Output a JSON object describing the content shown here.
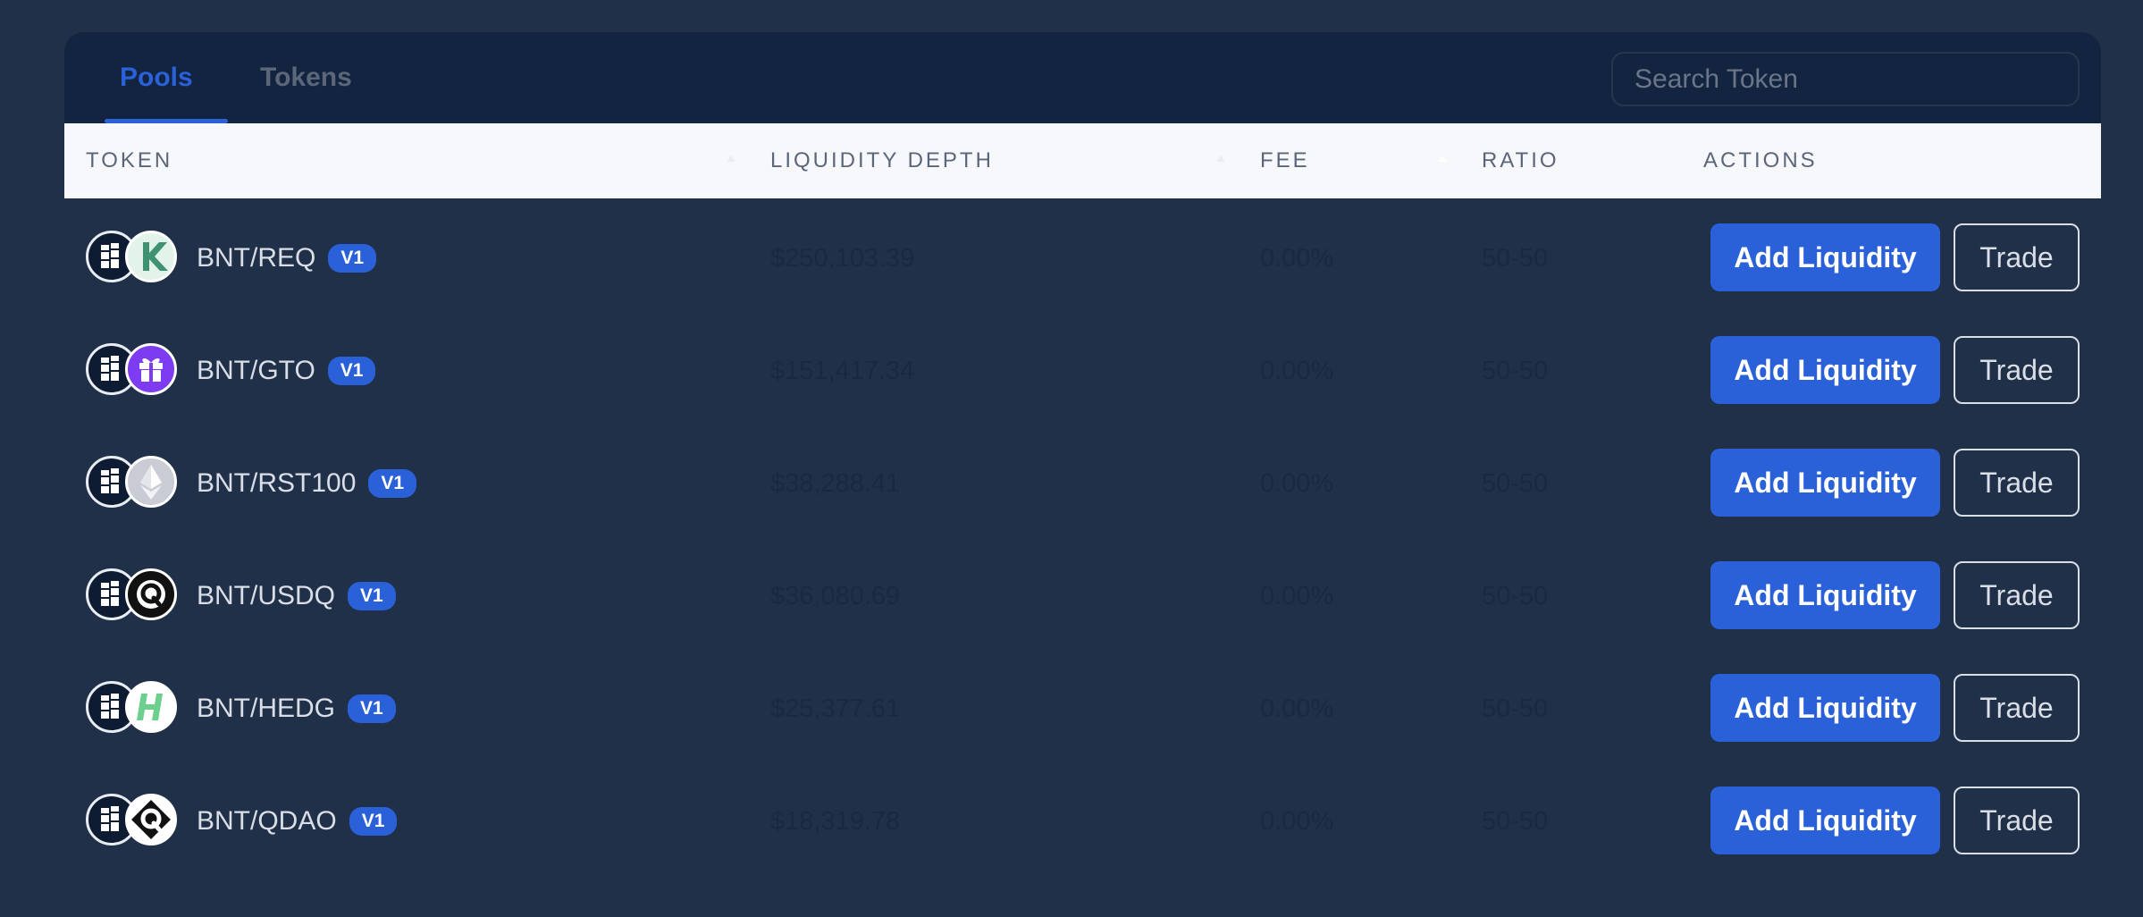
{
  "tabs": [
    {
      "label": "Pools",
      "active": true
    },
    {
      "label": "Tokens",
      "active": false
    }
  ],
  "search": {
    "placeholder": "Search Token",
    "value": ""
  },
  "table": {
    "columns": [
      "TOKEN",
      "LIQUIDITY DEPTH",
      "FEE",
      "RATIO",
      "ACTIONS"
    ],
    "actions": {
      "add_label": "Add Liquidity",
      "trade_label": "Trade"
    },
    "rows": [
      {
        "pair": "BNT/REQ",
        "version": "V1",
        "liquidity": "$250,103.39",
        "fee": "0.00%",
        "ratio": "50-50",
        "icon": "request-network-icon"
      },
      {
        "pair": "BNT/GTO",
        "version": "V1",
        "liquidity": "$151,417.34",
        "fee": "0.00%",
        "ratio": "50-50",
        "icon": "gift-icon"
      },
      {
        "pair": "BNT/RST100",
        "version": "V1",
        "liquidity": "$38,288.41",
        "fee": "0.00%",
        "ratio": "50-50",
        "icon": "ethereum-icon"
      },
      {
        "pair": "BNT/USDQ",
        "version": "V1",
        "liquidity": "$36,080.69",
        "fee": "0.00%",
        "ratio": "50-50",
        "icon": "usdq-icon"
      },
      {
        "pair": "BNT/HEDG",
        "version": "V1",
        "liquidity": "$25,377.61",
        "fee": "0.00%",
        "ratio": "50-50",
        "icon": "hedge-icon"
      },
      {
        "pair": "BNT/QDAO",
        "version": "V1",
        "liquidity": "$18,319.78",
        "fee": "0.00%",
        "ratio": "50-50",
        "icon": "qdao-icon"
      }
    ]
  },
  "colors": {
    "accent": "#2a61d8",
    "background": "#213049",
    "header_bar": "#122440",
    "table_head": "#f6f8fc"
  }
}
